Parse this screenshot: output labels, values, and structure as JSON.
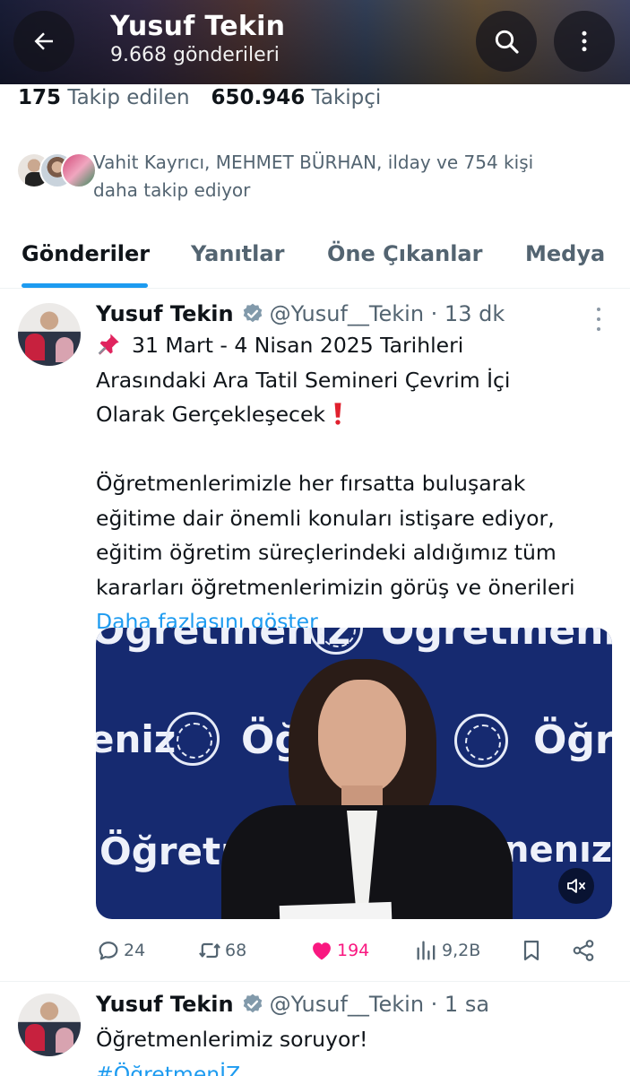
{
  "header": {
    "name": "Yusuf Tekin",
    "post_count": "9.668 gönderileri"
  },
  "profile": {
    "following_count": "175",
    "following_label": "Takip edilen",
    "followers_count": "650.946",
    "followers_label": "Takipçi",
    "followed_by_line1": "Vahit Kayrıcı, MEHMET BÜRHAN, ilday ve 754 kişi",
    "followed_by_line2": "daha takip ediyor"
  },
  "tabs": [
    {
      "label": "Gönderiler",
      "active": true
    },
    {
      "label": "Yanıtlar",
      "active": false
    },
    {
      "label": "Öne Çıkanlar",
      "active": false
    },
    {
      "label": "Medya",
      "active": false
    }
  ],
  "posts": [
    {
      "name": "Yusuf Tekin",
      "handle_time": "@Yusuf__Tekin · 13 dk",
      "lines": [
        "31 Mart - 4 Nisan 2025 Tarihleri",
        "Arasındaki Ara Tatil Semineri Çevrim İçi",
        "Olarak Gerçekleşecek",
        "Öğretmenlerimizle her fırsatta buluşarak",
        "eğitime dair önemli konuları istişare ediyor,",
        "eğitim öğretim süreçlerindeki aldığımız tüm",
        "kararları öğretmenlerimizin görüş ve önerileri"
      ],
      "show_more": "Daha fazlasını göster",
      "media_text": {
        "top": "Öğretmeniz",
        "left": "eniz",
        "right": "Öğre",
        "bottom_left": "Öğretme",
        "bottom_right": "nenız"
      },
      "stats": {
        "replies": "24",
        "reposts": "68",
        "likes": "194",
        "views": "9,2B"
      }
    },
    {
      "name": "Yusuf Tekin",
      "handle_time": "@Yusuf__Tekin · 1 sa",
      "line1": "Öğretmenlerimiz soruyor!",
      "hashtag": "#ÖğretmenİZ"
    }
  ],
  "icons": [
    "back-arrow-icon",
    "search-icon",
    "more-vertical-icon",
    "verified-badge-icon",
    "pushpin-icon",
    "exclamation-icon",
    "reply-icon",
    "repost-icon",
    "like-icon",
    "views-icon",
    "bookmark-icon",
    "share-icon",
    "mute-icon"
  ],
  "colors": {
    "accent": "#1d9bf0",
    "like": "#f91880",
    "secondary_text": "#536471"
  }
}
